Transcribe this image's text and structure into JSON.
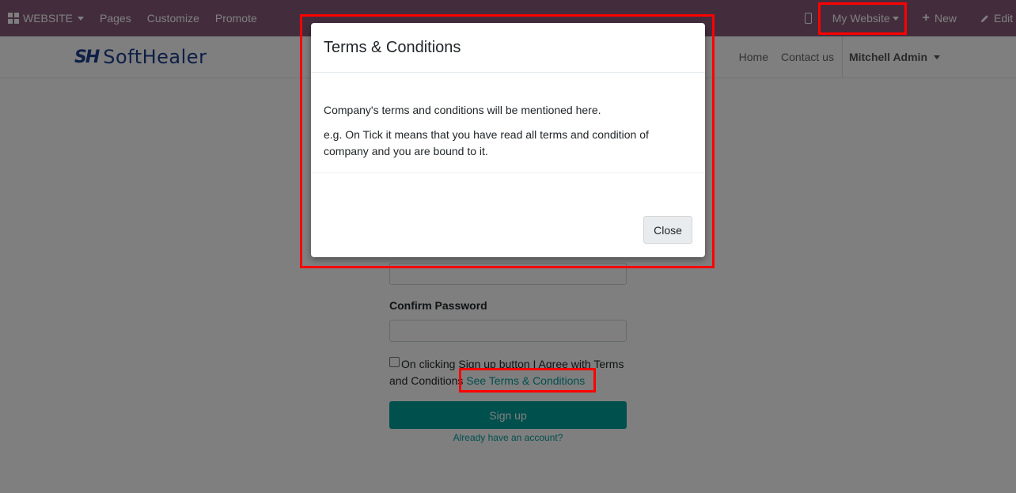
{
  "topbar": {
    "apps_label": "WEBSITE",
    "menu": [
      "Pages",
      "Customize",
      "Promote"
    ],
    "website_label": "My Website",
    "new_label": "New",
    "edit_label": "Edit"
  },
  "site": {
    "logo_mark": "SH",
    "logo_text": "SoftHealer",
    "nav": [
      "Home",
      "Contact us"
    ],
    "user": "Mitchell Admin"
  },
  "form": {
    "confirm_password_label": "Confirm Password",
    "agree_text": "On clicking Sign up button I Agree with Terms and Conditions",
    "terms_link": "See Terms & Conditions",
    "signup_label": "Sign up",
    "already_link": "Already have an account?"
  },
  "modal": {
    "title": "Terms & Conditions",
    "body_line1": "Company's terms and conditions will be mentioned here.",
    "body_line2": "e.g. On Tick it means that you have read all terms and condition of company and you are bound to it.",
    "close_label": "Close"
  },
  "colors": {
    "topbar": "#875a7b",
    "accent": "#00a09d",
    "highlight": "#ff0000"
  }
}
